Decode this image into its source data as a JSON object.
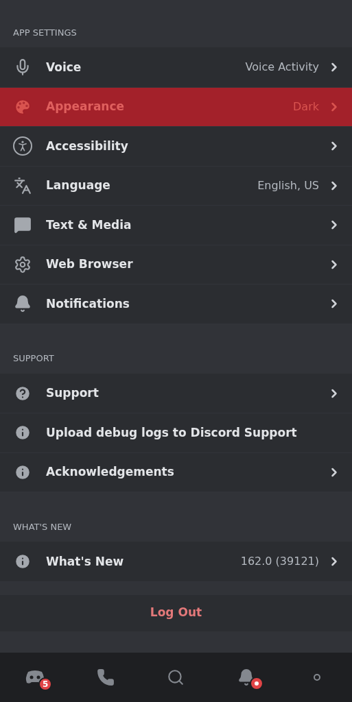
{
  "sections": [
    {
      "title": "APP SETTINGS",
      "items": [
        {
          "kind": "mic",
          "label": "Voice",
          "value": "Voice Activity",
          "chevron": true,
          "selected": false
        },
        {
          "kind": "palette",
          "label": "Appearance",
          "value": "Dark",
          "chevron": true,
          "selected": true
        },
        {
          "kind": "accessibility",
          "label": "Accessibility",
          "chevron": true,
          "selected": false
        },
        {
          "kind": "language",
          "label": "Language",
          "value": "English, US",
          "chevron": true,
          "selected": false
        },
        {
          "kind": "image",
          "label": "Text & Media",
          "chevron": true,
          "selected": false
        },
        {
          "kind": "gear",
          "label": "Web Browser",
          "chevron": true,
          "selected": false
        },
        {
          "kind": "bell",
          "label": "Notifications",
          "chevron": true,
          "selected": false
        }
      ]
    },
    {
      "title": "SUPPORT",
      "items": [
        {
          "kind": "help",
          "label": "Support",
          "chevron": true,
          "selected": false
        },
        {
          "kind": "info",
          "label": "Upload debug logs to Discord Support",
          "chevron": false,
          "selected": false
        },
        {
          "kind": "info",
          "label": "Acknowledgements",
          "chevron": true,
          "selected": false
        }
      ]
    },
    {
      "title": "WHAT'S NEW",
      "items": [
        {
          "kind": "info",
          "label": "What's New",
          "value": "162.0 (39121)",
          "chevron": true,
          "selected": false
        }
      ]
    }
  ],
  "logout": {
    "label": "Log Out"
  },
  "nav": [
    {
      "kind": "home",
      "badge": "5",
      "dot": false
    },
    {
      "kind": "friends",
      "dot": false
    },
    {
      "kind": "search",
      "dot": false
    },
    {
      "kind": "bell",
      "dot": true
    },
    {
      "kind": "profile",
      "dot": false
    }
  ]
}
